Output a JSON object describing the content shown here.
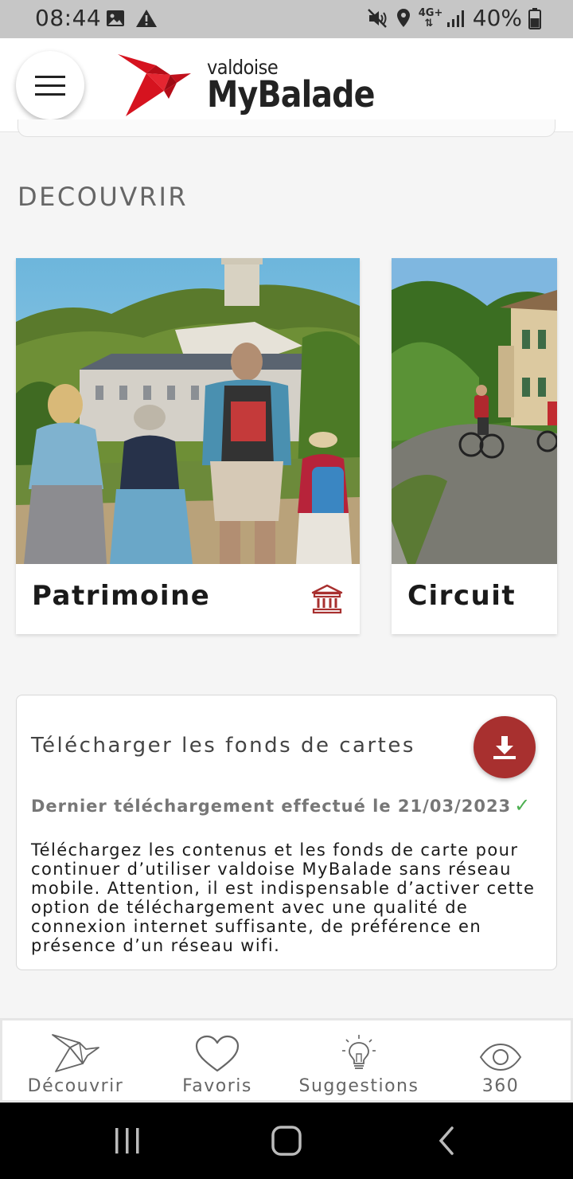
{
  "status_bar": {
    "time": "08:44",
    "battery": "40%",
    "network": "4G+",
    "icons": [
      "image-icon",
      "warning-icon",
      "mute-icon",
      "location-icon",
      "signal-icon",
      "battery-icon"
    ]
  },
  "header": {
    "logo_small": "valdoise",
    "logo_big": "MyBalade",
    "menu_icon": "hamburger-menu-icon",
    "accent_color": "#d6131f"
  },
  "section": {
    "title": "DECOUVRIR"
  },
  "cards": [
    {
      "label": "Patrimoine",
      "icon": "monument-icon"
    },
    {
      "label": "Circuit",
      "icon": ""
    }
  ],
  "download": {
    "title": "Télécharger les fonds de cartes",
    "last_download": "Dernier téléchargement effectué le 21/03/2023",
    "description": "Téléchargez les contenus et les fonds de carte pour continuer d’utiliser valdoise MyBalade sans réseau mobile. Attention, il est indispensable d’activer cette option de téléchargement avec une qualité de connexion internet suffisante, de préférence en présence d’un réseau wifi.",
    "button_icon": "download-icon",
    "button_color": "#a8302f"
  },
  "bottom_nav": [
    {
      "label": "Découvrir",
      "icon": "origami-bird-icon"
    },
    {
      "label": "Favoris",
      "icon": "heart-icon"
    },
    {
      "label": "Suggestions",
      "icon": "lightbulb-icon"
    },
    {
      "label": "360",
      "icon": "eye-icon"
    }
  ]
}
